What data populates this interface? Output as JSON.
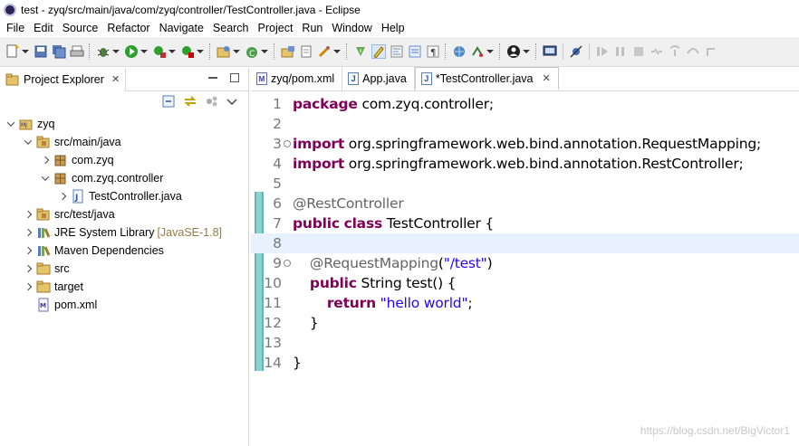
{
  "window": {
    "title": "test - zyq/src/main/java/com/zyq/controller/TestController.java - Eclipse"
  },
  "menu": [
    "File",
    "Edit",
    "Source",
    "Refactor",
    "Navigate",
    "Search",
    "Project",
    "Run",
    "Window",
    "Help"
  ],
  "project_explorer": {
    "title": "Project Explorer",
    "tree": [
      {
        "label": "zyq",
        "depth": 0,
        "state": "expanded",
        "icon": "maven-project-icon"
      },
      {
        "label": "src/main/java",
        "depth": 1,
        "state": "expanded",
        "icon": "source-folder-icon"
      },
      {
        "label": "com.zyq",
        "depth": 2,
        "state": "collapsed",
        "icon": "package-icon"
      },
      {
        "label": "com.zyq.controller",
        "depth": 2,
        "state": "expanded",
        "icon": "package-icon"
      },
      {
        "label": "TestController.java",
        "depth": 3,
        "state": "collapsed",
        "icon": "java-file-icon"
      },
      {
        "label": "src/test/java",
        "depth": 1,
        "state": "collapsed",
        "icon": "source-folder-icon"
      },
      {
        "label": "JRE System Library",
        "decoration": "[JavaSE-1.8]",
        "depth": 1,
        "state": "collapsed",
        "icon": "library-icon"
      },
      {
        "label": "Maven Dependencies",
        "depth": 1,
        "state": "collapsed",
        "icon": "library-icon"
      },
      {
        "label": "src",
        "depth": 1,
        "state": "collapsed",
        "icon": "folder-icon"
      },
      {
        "label": "target",
        "depth": 1,
        "state": "collapsed",
        "icon": "folder-icon"
      },
      {
        "label": "pom.xml",
        "depth": 1,
        "state": "none",
        "icon": "maven-pom-icon"
      }
    ]
  },
  "editor": {
    "tabs": [
      {
        "label": "zyq/pom.xml",
        "icon": "maven-pom-icon",
        "active": false
      },
      {
        "label": "App.java",
        "icon": "java-file-icon",
        "active": false
      },
      {
        "label": "*TestController.java",
        "icon": "java-file-icon",
        "active": true
      }
    ],
    "current_line": 8,
    "lines": [
      {
        "n": "1",
        "fold": false,
        "tokens": [
          {
            "t": "package",
            "c": "kw"
          },
          {
            "t": " com.zyq.controller;",
            "c": ""
          }
        ]
      },
      {
        "n": "2",
        "fold": false,
        "tokens": []
      },
      {
        "n": "3",
        "fold": true,
        "tokens": [
          {
            "t": "import",
            "c": "kw"
          },
          {
            "t": " org.springframework.web.bind.annotation.RequestMapping;",
            "c": ""
          }
        ]
      },
      {
        "n": "4",
        "fold": false,
        "tokens": [
          {
            "t": "import",
            "c": "kw"
          },
          {
            "t": " org.springframework.web.bind.annotation.RestController;",
            "c": ""
          }
        ]
      },
      {
        "n": "5",
        "fold": false,
        "tokens": []
      },
      {
        "n": "6",
        "fold": false,
        "tokens": [
          {
            "t": "@RestController",
            "c": "ann"
          }
        ]
      },
      {
        "n": "7",
        "fold": false,
        "tokens": [
          {
            "t": "public",
            "c": "kw"
          },
          {
            "t": " ",
            "c": ""
          },
          {
            "t": "class",
            "c": "kw"
          },
          {
            "t": " TestController {",
            "c": ""
          }
        ]
      },
      {
        "n": "8",
        "fold": false,
        "tokens": []
      },
      {
        "n": "9",
        "fold": true,
        "tokens": [
          {
            "t": "    ",
            "c": ""
          },
          {
            "t": "@RequestMapping",
            "c": "ann"
          },
          {
            "t": "(",
            "c": ""
          },
          {
            "t": "\"/test\"",
            "c": "str"
          },
          {
            "t": ")",
            "c": ""
          }
        ]
      },
      {
        "n": "10",
        "fold": false,
        "tokens": [
          {
            "t": "    ",
            "c": ""
          },
          {
            "t": "public",
            "c": "kw"
          },
          {
            "t": " String test() {",
            "c": ""
          }
        ]
      },
      {
        "n": "11",
        "fold": false,
        "tokens": [
          {
            "t": "        ",
            "c": ""
          },
          {
            "t": "return",
            "c": "kw"
          },
          {
            "t": " ",
            "c": ""
          },
          {
            "t": "\"hello world\"",
            "c": "str"
          },
          {
            "t": ";",
            "c": ""
          }
        ]
      },
      {
        "n": "12",
        "fold": false,
        "tokens": [
          {
            "t": "    }",
            "c": ""
          }
        ]
      },
      {
        "n": "13",
        "fold": false,
        "tokens": []
      },
      {
        "n": "14",
        "fold": false,
        "tokens": [
          {
            "t": "}",
            "c": ""
          }
        ]
      }
    ]
  },
  "watermark": "https://blog.csdn.net/BigVictor1"
}
